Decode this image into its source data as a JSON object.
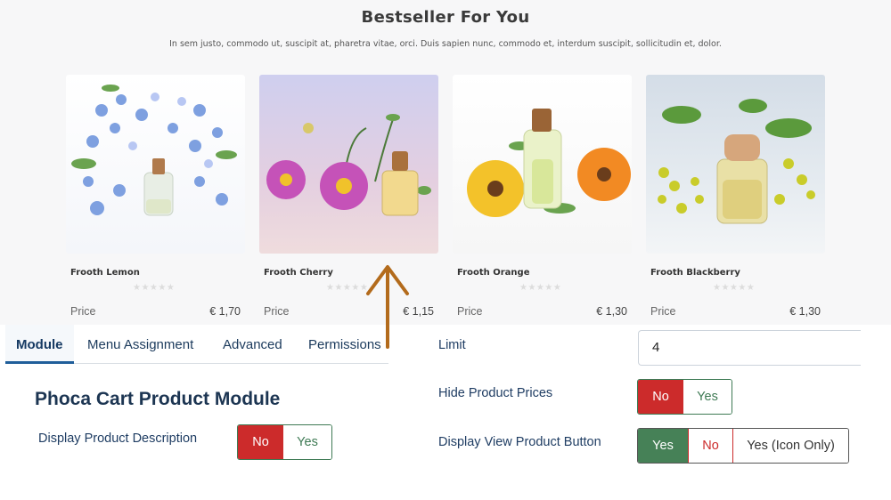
{
  "store": {
    "title": "Bestseller For You",
    "subtitle": "In sem justo, commodo ut, suscipit at, pharetra vitae, orci. Duis sapien nunc, commodo et, interdum suscipit, sollicitudin et, dolor.",
    "stars": "★★★★★",
    "products": [
      {
        "name": "Frooth Lemon",
        "price_label": "Price",
        "price": "€ 1,70"
      },
      {
        "name": "Frooth Cherry",
        "price_label": "Price",
        "price": "€ 1,15"
      },
      {
        "name": "Frooth Orange",
        "price_label": "Price",
        "price": "€ 1,30"
      },
      {
        "name": "Frooth Blackberry",
        "price_label": "Price",
        "price": "€ 1,30"
      }
    ]
  },
  "tabs": [
    {
      "label": "Module",
      "active": true
    },
    {
      "label": "Menu Assignment",
      "active": false
    },
    {
      "label": "Advanced",
      "active": false
    },
    {
      "label": "Permissions",
      "active": false
    }
  ],
  "module": {
    "title": "Phoca Cart Product Module",
    "display_description": {
      "label": "Display Product Description",
      "no": "No",
      "yes": "Yes",
      "value": "No"
    },
    "limit": {
      "label": "Limit",
      "value": "4"
    },
    "hide_prices": {
      "label": "Hide Product Prices",
      "no": "No",
      "yes": "Yes",
      "value": "No"
    },
    "view_button": {
      "label": "Display View Product Button",
      "yes": "Yes",
      "no": "No",
      "icon_only": "Yes (Icon Only)",
      "value": "Yes"
    }
  },
  "colors": {
    "no_active": "#cc2b2b",
    "yes_active": "#468157",
    "annotation_arrow": "#b36b1c"
  },
  "icons": {
    "annotation": "arrow-up-icon"
  }
}
